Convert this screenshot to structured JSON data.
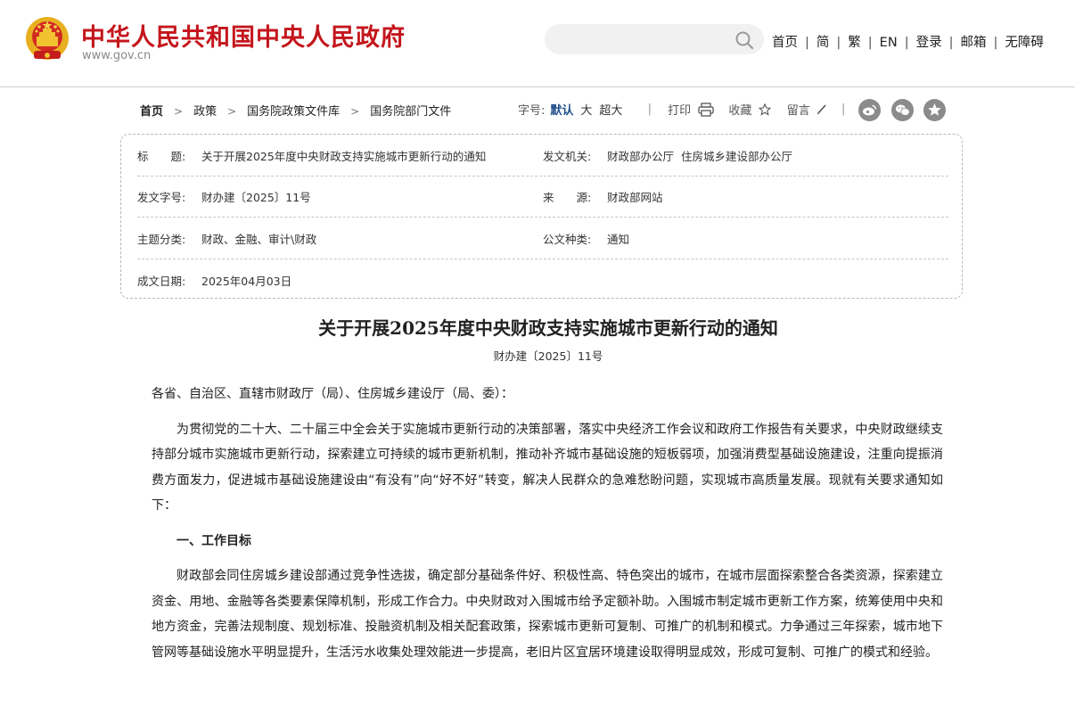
{
  "header": {
    "site_title": "中华人民共和国中央人民政府",
    "site_url": "www.gov.cn",
    "search_placeholder": "",
    "nav": [
      "首页",
      "简",
      "繁",
      "EN",
      "登录",
      "邮箱",
      "无障碍"
    ],
    "colors": {
      "brand_red": "#c4161c",
      "accent_blue": "#1f4e8a"
    }
  },
  "breadcrumb": [
    "首页",
    "政策",
    "国务院政策文件库",
    "国务院部门文件"
  ],
  "toolbar": {
    "font_label": "字号:",
    "font_options": [
      "默认",
      "大",
      "超大"
    ],
    "font_selected": "默认",
    "print": "打印",
    "favorite": "收藏",
    "comment": "留言",
    "share_icons": [
      "weibo-icon",
      "wechat-icon",
      "star-icon"
    ]
  },
  "info": {
    "title_label": "标　　题:",
    "title_value": "关于开展2025年度中央财政支持实施城市更新行动的通知",
    "issuer_label": "发文机关:",
    "issuer_value": "财政部办公厅  住房城乡建设部办公厅",
    "doc_no_label": "发文字号:",
    "doc_no_value": "财办建〔2025〕11号",
    "source_label": "来　　源:",
    "source_value": "财政部网站",
    "topic_label": "主题分类:",
    "topic_value": "财政、金融、审计\\财政",
    "type_label": "公文种类:",
    "type_value": "通知",
    "date_label": "成文日期:",
    "date_value": "2025年04月03日"
  },
  "article": {
    "title": "关于开展2025年度中央财政支持实施城市更新行动的通知",
    "number": "财办建〔2025〕11号",
    "salutation": "各省、自治区、直辖市财政厅（局）、住房城乡建设厅（局、委）：",
    "para1": "为贯彻党的二十大、二十届三中全会关于实施城市更新行动的决策部署，落实中央经济工作会议和政府工作报告有关要求，中央财政继续支持部分城市实施城市更新行动，探索建立可持续的城市更新机制，推动补齐城市基础设施的短板弱项，加强消费型基础设施建设，注重向提振消费方面发力，促进城市基础设施建设由“有没有”向“好不好”转变，解决人民群众的急难愁盼问题，实现城市高质量发展。现就有关要求通知如下：",
    "heading1": "一、工作目标",
    "para2": "财政部会同住房城乡建设部通过竞争性选拔，确定部分基础条件好、积极性高、特色突出的城市，在城市层面探索整合各类资源，探索建立资金、用地、金融等各类要素保障机制，形成工作合力。中央财政对入围城市给予定额补助。入围城市制定城市更新工作方案，统筹使用中央和地方资金，完善法规制度、规划标准、投融资机制及相关配套政策，探索城市更新可复制、可推广的机制和模式。力争通过三年探索，城市地下管网等基础设施水平明显提升，生活污水收集处理效能进一步提高，老旧片区宜居环境建设取得明显成效，形成可复制、可推广的模式和经验。"
  }
}
